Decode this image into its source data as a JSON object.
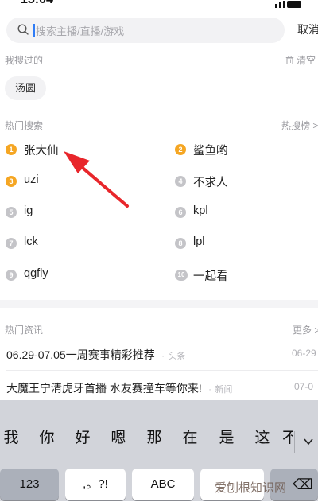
{
  "status": {
    "time": "15:04"
  },
  "search": {
    "placeholder": "搜索主播/直播/游戏",
    "cancel": "取消"
  },
  "history": {
    "title": "我搜过的",
    "clear": "清空",
    "chips": [
      "汤圆"
    ]
  },
  "hot": {
    "title": "热门搜索",
    "link": "热搜榜",
    "items": [
      {
        "rank": "1",
        "label": "张大仙"
      },
      {
        "rank": "2",
        "label": "鲨鱼哟"
      },
      {
        "rank": "3",
        "label": "uzi"
      },
      {
        "rank": "4",
        "label": "不求人"
      },
      {
        "rank": "5",
        "label": "ig"
      },
      {
        "rank": "6",
        "label": "kpl"
      },
      {
        "rank": "7",
        "label": "lck"
      },
      {
        "rank": "8",
        "label": "lpl"
      },
      {
        "rank": "9",
        "label": "qgfly"
      },
      {
        "rank": "10",
        "label": "一起看"
      }
    ]
  },
  "news": {
    "title": "热门资讯",
    "more": "更多",
    "items": [
      {
        "title": "06.29-07.05一周赛事精彩推荐",
        "source": "头条",
        "date": "06-29"
      },
      {
        "title": "大魔王宁清虎牙首播 水友赛撞车等你来!",
        "source": "新闻",
        "date": "07-0"
      }
    ]
  },
  "keyboard": {
    "candidates": [
      "我",
      "你",
      "好",
      "嗯",
      "那",
      "在",
      "是",
      "这",
      "不"
    ],
    "keys": {
      "numbers": "123",
      "punct": ",。?!",
      "abc": "ABC",
      "space": "",
      "delete": "⌫"
    }
  },
  "watermark": "爱刨根知识网",
  "colors": {
    "rank_top": "#f5a623",
    "rank_rest": "#c4c4c8",
    "arrow": "#e8262b",
    "caret": "#2f7cf6"
  }
}
